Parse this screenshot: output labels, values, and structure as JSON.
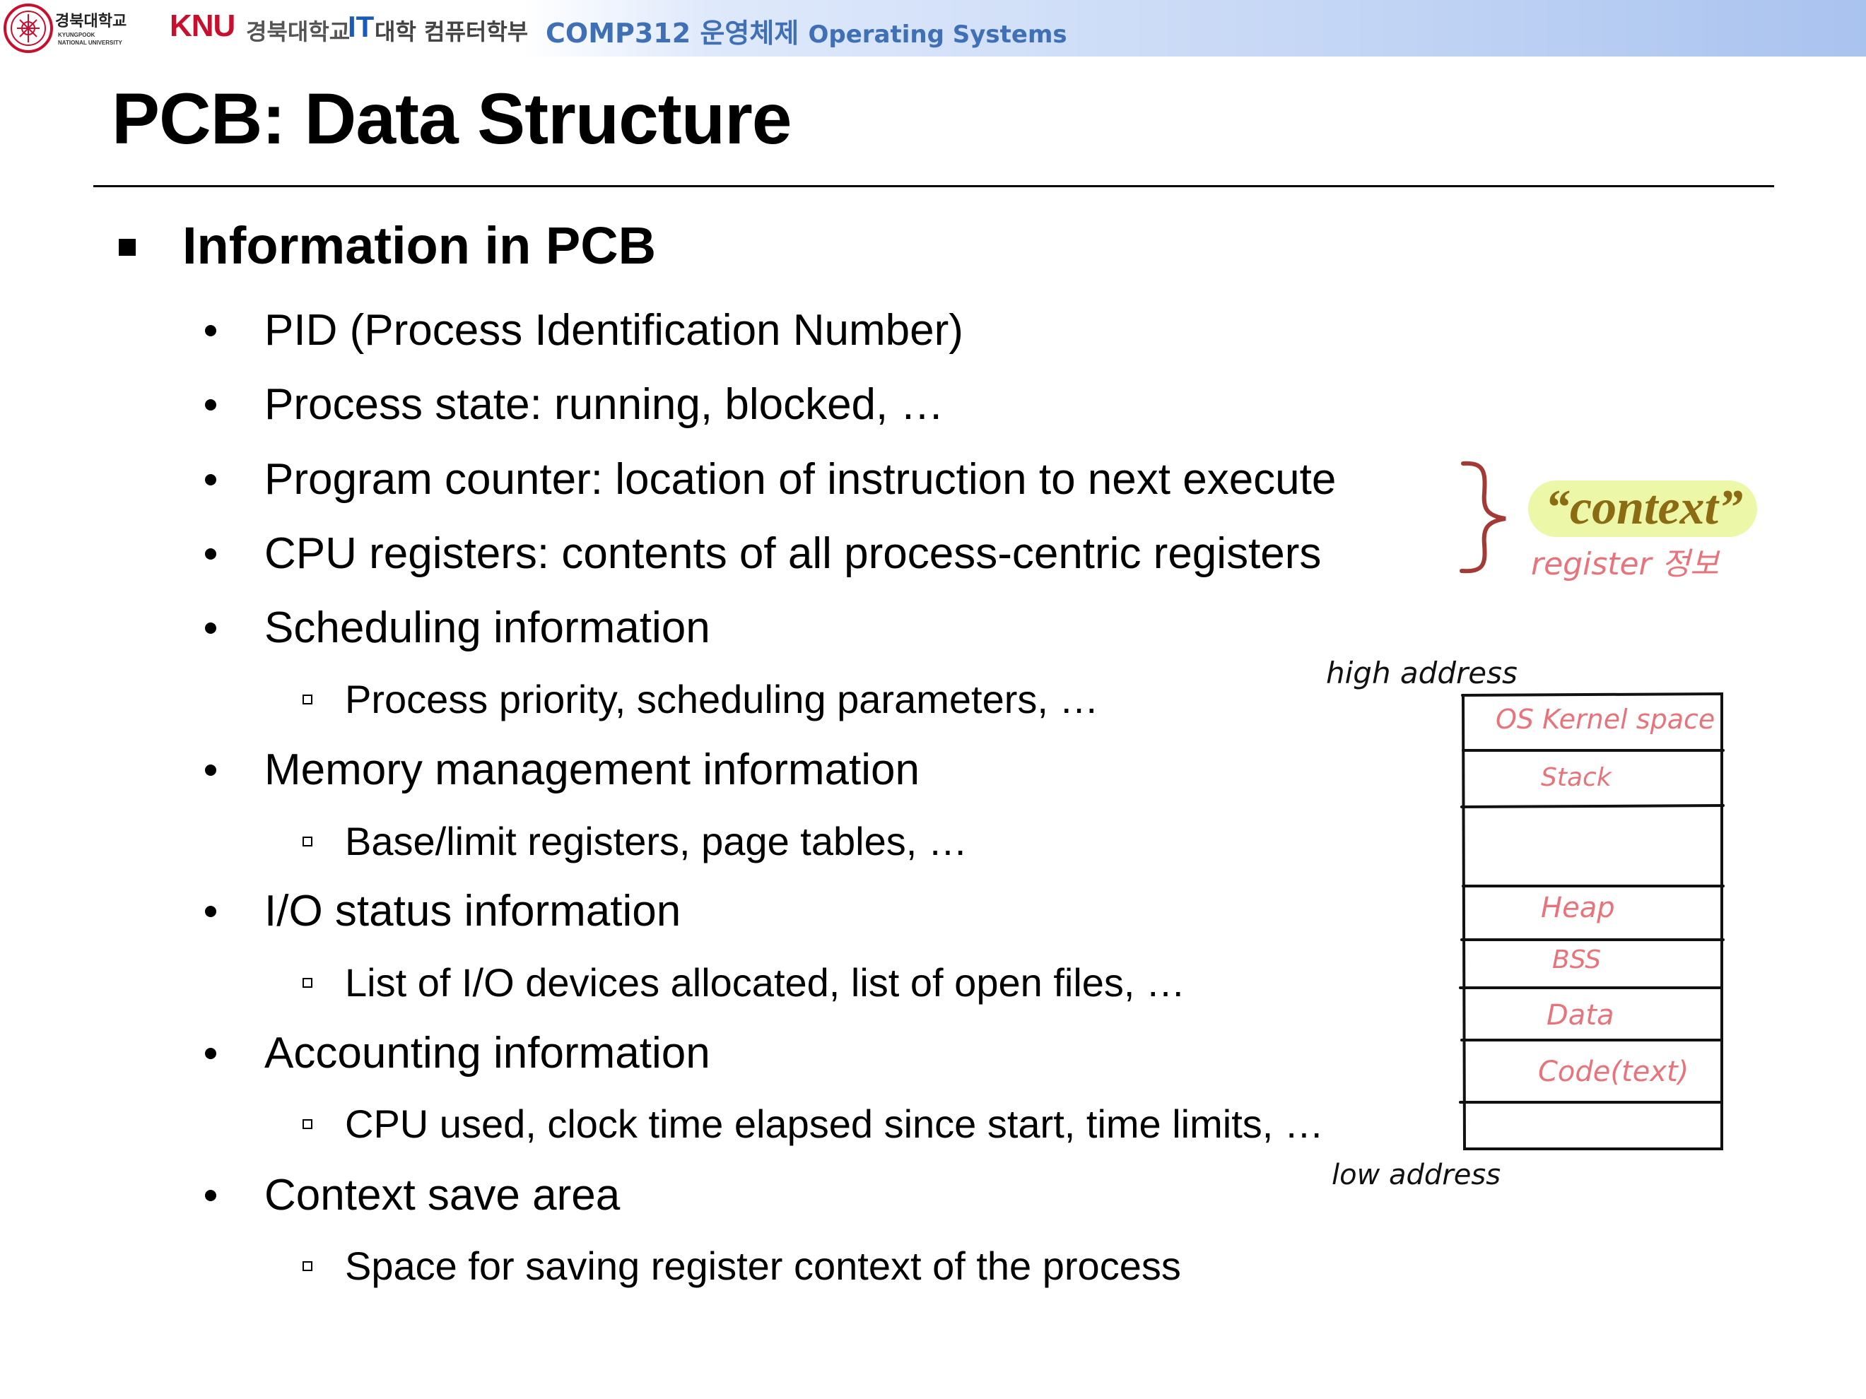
{
  "header": {
    "univ_name_kor": "경북대학교",
    "univ_name_eng_1": "KYUNGPOOK",
    "univ_name_eng_2": "NATIONAL UNIVERSITY",
    "knu_mark": "KNU",
    "knu_kor": "경북대학교",
    "it_mark": "IT",
    "it_rest": "대학 컴퓨터학부",
    "course_code": "COMP312 운영체제",
    "course_name": "Operating Systems"
  },
  "slide": {
    "title": "PCB: Data Structure",
    "heading": "Information in PCB",
    "items": [
      {
        "text": "PID (Process Identification Number)"
      },
      {
        "text": "Process state: running, blocked, …"
      },
      {
        "text": "Program counter: location of instruction to next execute"
      },
      {
        "text": "CPU registers: contents of all process-centric registers"
      },
      {
        "text": "Scheduling information",
        "sub": "Process priority, scheduling parameters, …"
      },
      {
        "text": "Memory management information",
        "sub": "Base/limit registers, page tables, …"
      },
      {
        "text": "I/O status information",
        "sub": "List of I/O devices allocated, list of open files, …"
      },
      {
        "text": "Accounting information",
        "sub": "CPU used, clock time elapsed since start, time limits, …"
      },
      {
        "text": "Context save area",
        "sub": "Space for saving register context of the process"
      }
    ]
  },
  "annotations": {
    "context_label": "“context”",
    "register_note": "register 정보",
    "high_address": "high address",
    "low_address": "low address",
    "memory_layout": [
      "OS Kernel space",
      "Stack",
      "",
      "Heap",
      "BSS",
      "Data",
      "Code(text)",
      ""
    ]
  },
  "colors": {
    "course_blue": "#3f6fb5",
    "knu_red": "#c8102e",
    "handwriting_red": "#e8737a",
    "brace_red": "#a33a36",
    "highlight_yellow": "#ecf7a8",
    "context_text": "#8b6c12"
  }
}
